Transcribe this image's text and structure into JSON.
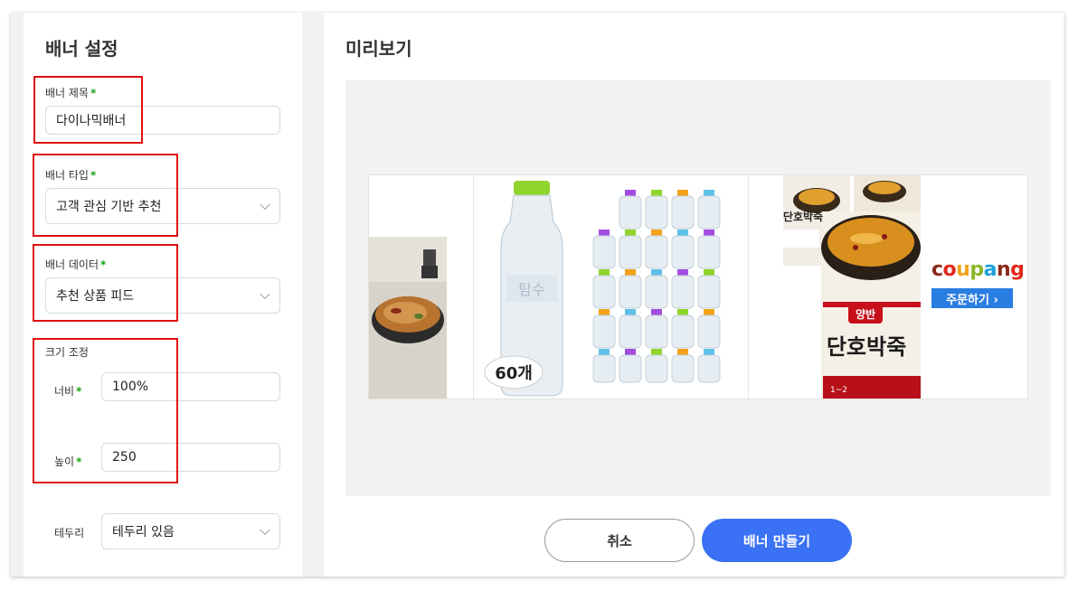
{
  "settings": {
    "title": "배너 설정",
    "banner_title": {
      "label": "배너 제목",
      "value": "다이나믹배너"
    },
    "banner_type": {
      "label": "배너 타입",
      "value": "고객 관심 기반 추천"
    },
    "banner_data": {
      "label": "배너 데이터",
      "value": "추천 상품 피드"
    },
    "size": {
      "label": "크기 조정",
      "width_label": "너비",
      "width_value": "100%",
      "height_label": "높이",
      "height_value": "250"
    },
    "border": {
      "label": "테두리",
      "value": "테두리 있음"
    },
    "required_mark": "*"
  },
  "preview": {
    "title": "미리보기",
    "water_count": "60개",
    "water_label": "탐수",
    "porridge_brand": "양반",
    "porridge_name": "단호박죽",
    "porridge_sub": "1~2",
    "coupang_logo": "coupang",
    "order_label": "주문하기 ›"
  },
  "actions": {
    "cancel": "취소",
    "create": "배너 만들기"
  },
  "colors": {
    "accent": "#3a71f5",
    "highlight": "#e01010",
    "required": "#1aa31a",
    "coupang_blue": "#2a7de1"
  }
}
